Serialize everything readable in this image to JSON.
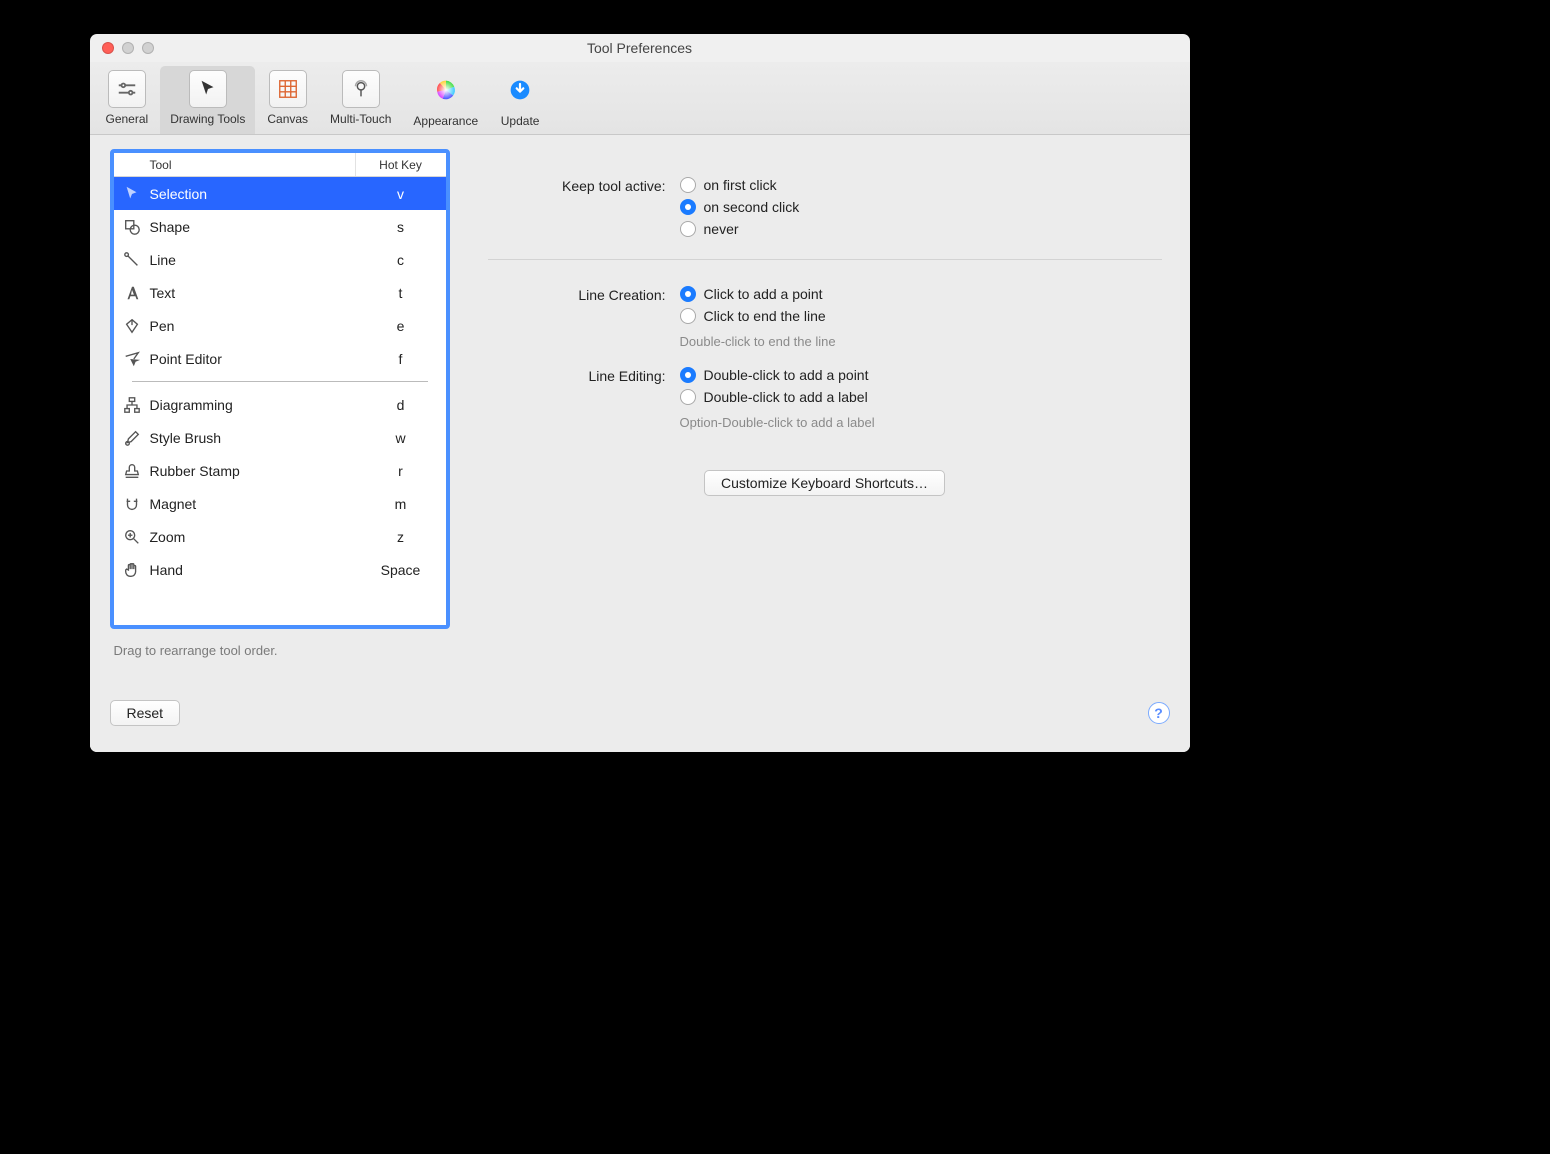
{
  "window": {
    "title": "Tool Preferences"
  },
  "tabs": [
    {
      "label": "General",
      "icon": "sliders"
    },
    {
      "label": "Drawing Tools",
      "icon": "cursor"
    },
    {
      "label": "Canvas",
      "icon": "grid"
    },
    {
      "label": "Multi-Touch",
      "icon": "touch"
    },
    {
      "label": "Appearance",
      "icon": "color"
    },
    {
      "label": "Update",
      "icon": "download"
    }
  ],
  "active_tab": 1,
  "tool_table": {
    "headers": {
      "tool": "Tool",
      "hotkey": "Hot Key"
    },
    "group1": [
      {
        "name": "Selection",
        "hotkey": "v",
        "icon": "cursor"
      },
      {
        "name": "Shape",
        "hotkey": "s",
        "icon": "shape"
      },
      {
        "name": "Line",
        "hotkey": "c",
        "icon": "line"
      },
      {
        "name": "Text",
        "hotkey": "t",
        "icon": "text"
      },
      {
        "name": "Pen",
        "hotkey": "e",
        "icon": "pen"
      },
      {
        "name": "Point Editor",
        "hotkey": "f",
        "icon": "point"
      }
    ],
    "group2": [
      {
        "name": "Diagramming",
        "hotkey": "d",
        "icon": "diagram"
      },
      {
        "name": "Style Brush",
        "hotkey": "w",
        "icon": "brush"
      },
      {
        "name": "Rubber Stamp",
        "hotkey": "r",
        "icon": "stamp"
      },
      {
        "name": "Magnet",
        "hotkey": "m",
        "icon": "magnet"
      },
      {
        "name": "Zoom",
        "hotkey": "z",
        "icon": "zoom"
      },
      {
        "name": "Hand",
        "hotkey": "Space",
        "icon": "hand"
      }
    ],
    "selected_index": 0,
    "hint": "Drag to rearrange tool order."
  },
  "settings": {
    "keep_active": {
      "label": "Keep tool active:",
      "options": [
        "on first click",
        "on second click",
        "never"
      ],
      "selected": 1
    },
    "line_creation": {
      "label": "Line Creation:",
      "options": [
        "Click to add a point",
        "Click to end the line"
      ],
      "selected": 0,
      "helper": "Double-click to end the line"
    },
    "line_editing": {
      "label": "Line Editing:",
      "options": [
        "Double-click to add a point",
        "Double-click to add a label"
      ],
      "selected": 0,
      "helper": "Option-Double-click to add a label"
    },
    "customize_button": "Customize Keyboard Shortcuts…"
  },
  "footer": {
    "reset": "Reset",
    "help": "?"
  }
}
